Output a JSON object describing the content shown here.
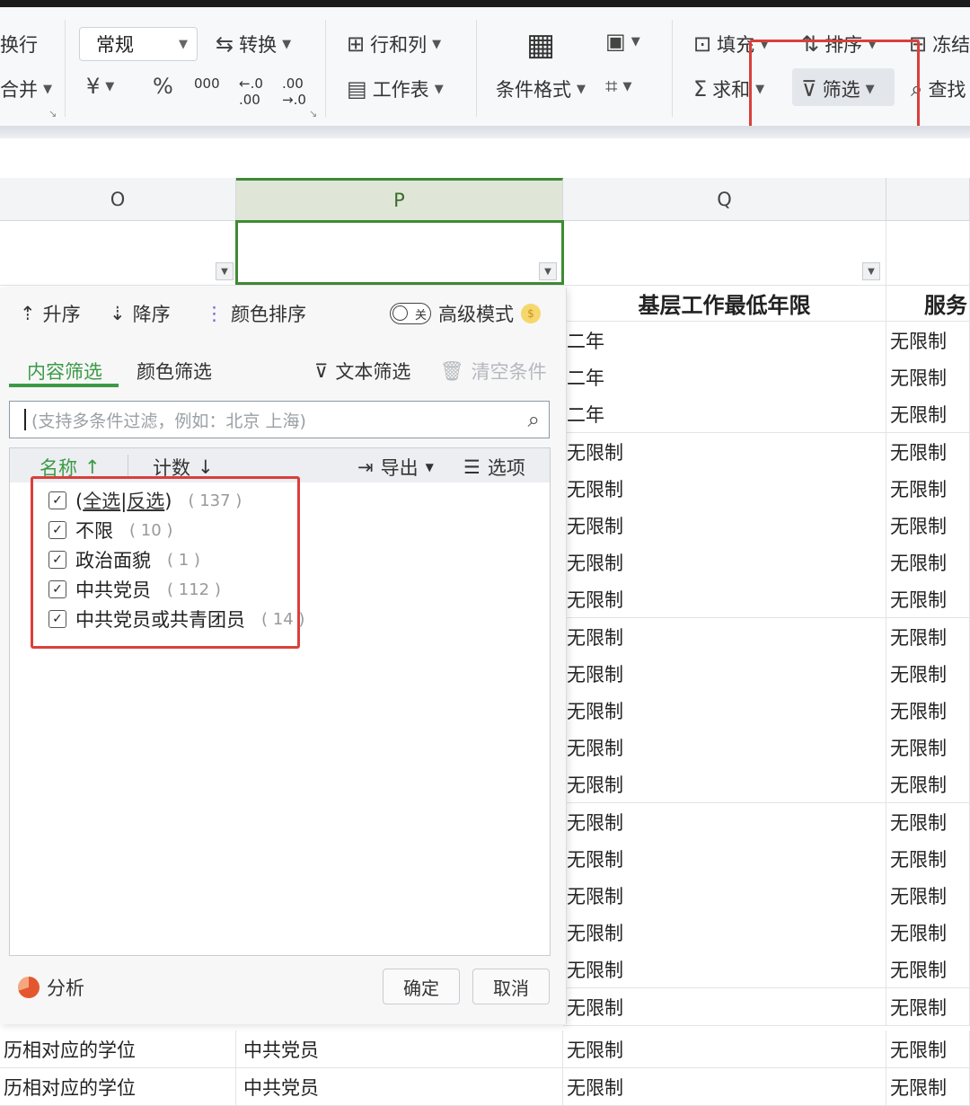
{
  "ribbon": {
    "left_partial_1": "换行",
    "left_partial_2": "合并",
    "number_format": "常规",
    "convert": "转换",
    "currency_symbol": "¥",
    "percent_symbol": "%",
    "thousands_symbol": "000",
    "rows_cols": "行和列",
    "worksheet": "工作表",
    "conditional_format": "条件格式",
    "fill": "填充",
    "sort": "排序",
    "freeze": "冻结",
    "sum": "求和",
    "filter": "筛选",
    "find": "查找"
  },
  "columns": [
    "O",
    "P",
    "Q"
  ],
  "header_cells": {
    "q": "基层工作最低年限",
    "r": "服务"
  },
  "filter_panel": {
    "sort_asc": "升序",
    "sort_desc": "降序",
    "color_sort": "颜色排序",
    "toggle_label": "关",
    "advanced_mode": "高级模式",
    "tab_content": "内容筛选",
    "tab_color": "颜色筛选",
    "text_filter": "文本筛选",
    "clear_conditions": "清空条件",
    "search_placeholder": "(支持多条件过滤，例如：北京  上海)",
    "col_name": "名称",
    "col_count": "计数",
    "export": "导出",
    "options": "选项",
    "select_all": "全选",
    "invert": "反选",
    "items": [
      {
        "label": "",
        "count": "( 137 )"
      },
      {
        "label": "不限",
        "count": "( 10 )"
      },
      {
        "label": "政治面貌",
        "count": "( 1 )"
      },
      {
        "label": "中共党员",
        "count": "( 112 )"
      },
      {
        "label": "中共党员或共青团员",
        "count": "( 14 )"
      }
    ],
    "analysis": "分析",
    "confirm": "确定",
    "cancel": "取消"
  },
  "grid_rows": [
    {
      "q": "二年",
      "r": "无限制"
    },
    {
      "q": "二年",
      "r": "无限制"
    },
    {
      "q": "二年",
      "r": "无限制"
    },
    {
      "q": "无限制",
      "r": "无限制"
    },
    {
      "q": "无限制",
      "r": "无限制"
    },
    {
      "q": "无限制",
      "r": "无限制"
    },
    {
      "q": "无限制",
      "r": "无限制"
    },
    {
      "q": "无限制",
      "r": "无限制"
    },
    {
      "q": "无限制",
      "r": "无限制"
    },
    {
      "q": "无限制",
      "r": "无限制"
    },
    {
      "q": "无限制",
      "r": "无限制"
    },
    {
      "q": "无限制",
      "r": "无限制"
    },
    {
      "q": "无限制",
      "r": "无限制"
    },
    {
      "q": "无限制",
      "r": "无限制"
    },
    {
      "q": "无限制",
      "r": "无限制"
    },
    {
      "q": "无限制",
      "r": "无限制"
    },
    {
      "q": "无限制",
      "r": "无限制"
    },
    {
      "q": "无限制",
      "r": "无限制"
    },
    {
      "q": "无限制",
      "r": "无限制"
    }
  ],
  "bottom_rows": [
    {
      "o": "历相对应的学位",
      "p": "中共党员",
      "q": "无限制",
      "r": "无限制"
    },
    {
      "o": "历相对应的学位",
      "p": "中共党员",
      "q": "无限制",
      "r": "无限制"
    }
  ],
  "colors": {
    "accent_green": "#3c9a46",
    "highlight_red": "#d9403b"
  }
}
